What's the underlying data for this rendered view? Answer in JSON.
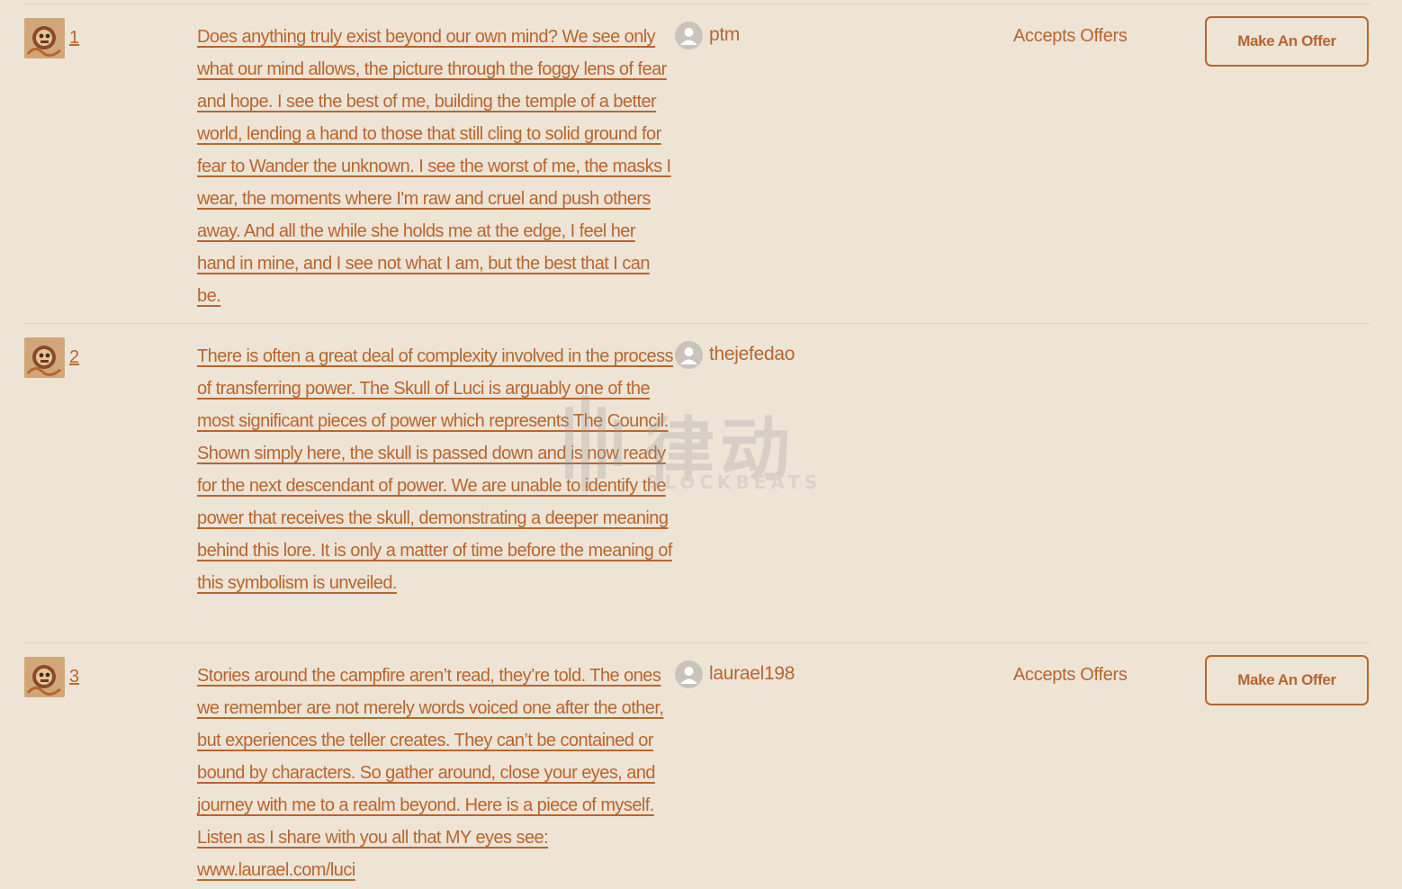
{
  "listings": [
    {
      "rank": "1",
      "description": "Does anything truly exist beyond our own mind? We see only what our mind allows, the picture through the foggy lens of fear and hope. I see the best of me, building the temple of a better world, lending a hand to those that still cling to solid ground for fear to Wander the unknown. I see the worst of me, the masks I wear, the moments where I'm raw and cruel and push others away. And all the while she holds me at the edge, I feel her hand in mine, and I see not what I am, but the best that I can be.",
      "owner": "ptm",
      "offer_status": "Accepts Offers",
      "offer_button": "Make An Offer"
    },
    {
      "rank": "2",
      "description": "There is often a great deal of complexity involved in the process of transferring power. The Skull of Luci is arguably one of the most significant pieces of power which represents The Council. Shown simply here, the skull is passed down and is now ready for the next descendant of power. We are unable to identify the power that receives the skull, demonstrating a deeper meaning behind this lore. It is only a matter of time before the meaning of this symbolism is unveiled.",
      "owner": "thejefedao",
      "offer_status": "",
      "offer_button": ""
    },
    {
      "rank": "3",
      "description": "Stories around the campfire aren’t read, they’re told. The ones we remember are not merely words voiced one after the other, but experiences the teller creates. They can’t be contained or bound by characters. So gather around, close your eyes, and journey with me to a realm beyond. Here is a piece of myself. Listen as I share with you all that MY eyes see: www.laurael.com/luci",
      "owner": "laurael198",
      "offer_status": "Accepts Offers",
      "offer_button": "Make An Offer"
    }
  ],
  "watermark": {
    "text": "律动",
    "subtext": "BLOCKBEATS"
  },
  "colors": {
    "background": "#ede4d6",
    "accent": "#b8662d",
    "divider": "#ddd3c4",
    "avatar": "#c9c3bc"
  },
  "icons": {
    "owner_avatar": "user-silhouette-icon",
    "thumbnail": "artwork-thumbnail"
  }
}
